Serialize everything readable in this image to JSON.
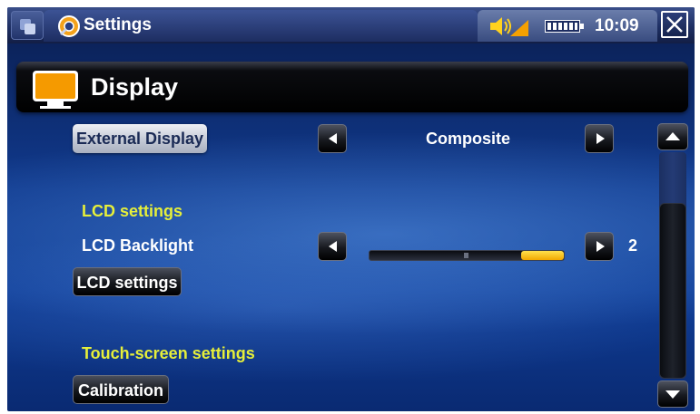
{
  "status_bar": {
    "app_title": "Settings",
    "time": "10:09",
    "icons": [
      "home-icon",
      "gear-icon",
      "speaker-icon",
      "battery-icon",
      "close-icon"
    ]
  },
  "header": {
    "title": "Display",
    "icon": "display-icon"
  },
  "external_display": {
    "button_label": "External Display",
    "value": "Composite"
  },
  "lcd": {
    "section_label": "LCD settings",
    "backlight_label": "LCD Backlight",
    "backlight_value": "2",
    "backlight_level_fraction": 0.22,
    "button_label": "LCD settings"
  },
  "touch": {
    "section_label": "Touch-screen settings",
    "button_label": "Calibration"
  },
  "colors": {
    "accent_yellow": "#e6ef3a",
    "slider_fill": "#f2a800",
    "background_blue": "#103a8e"
  }
}
